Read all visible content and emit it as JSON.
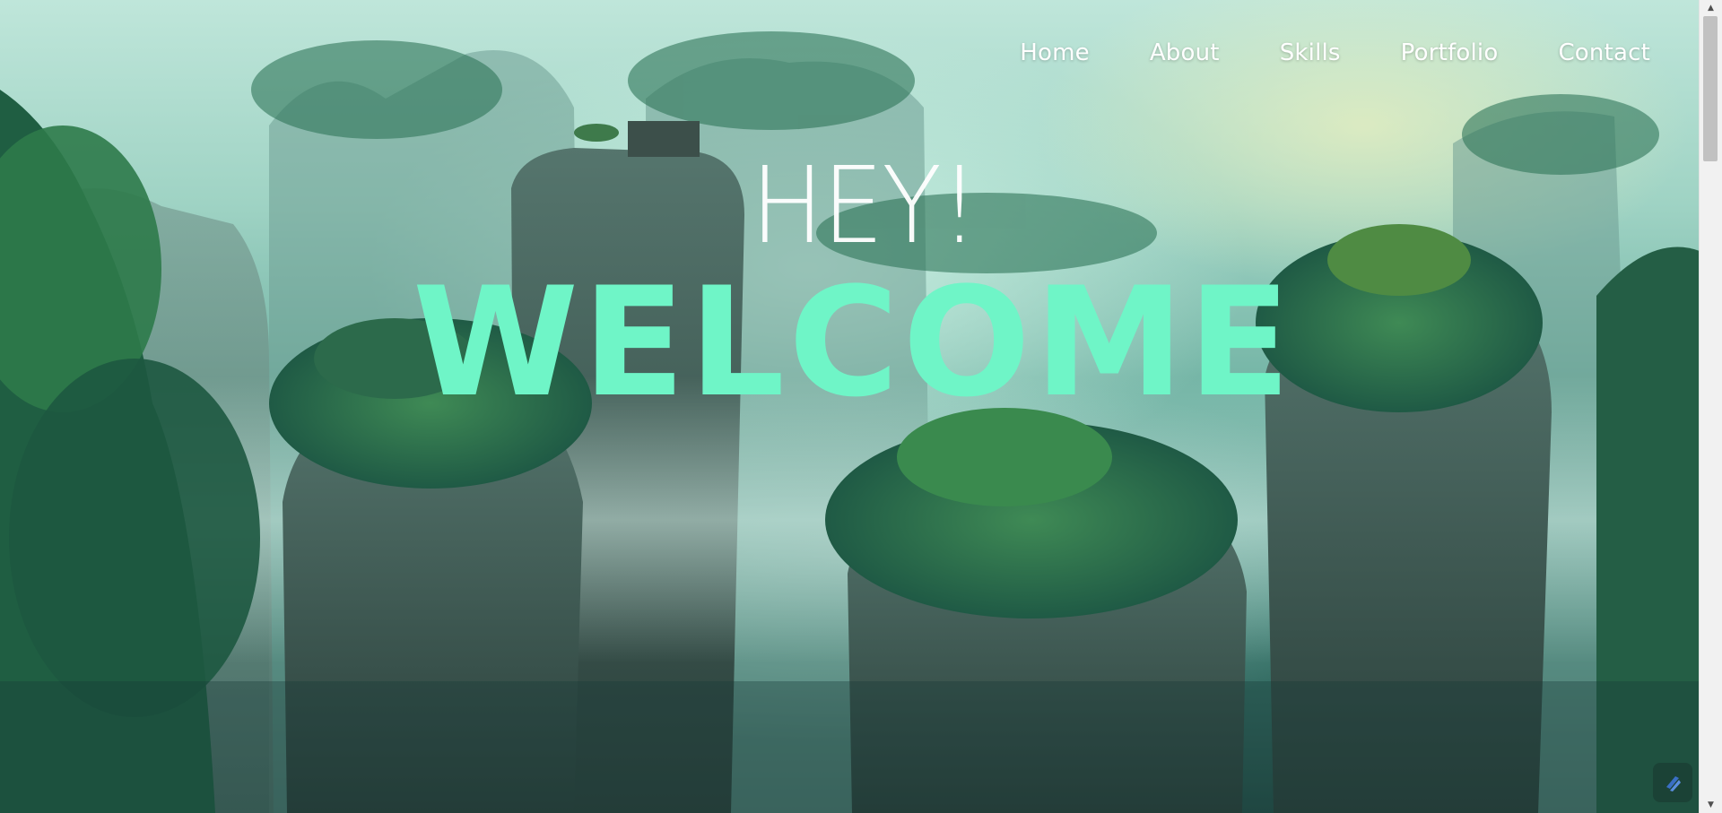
{
  "nav": {
    "items": [
      {
        "label": "Home"
      },
      {
        "label": "About"
      },
      {
        "label": "Skills"
      },
      {
        "label": "Portfolio"
      },
      {
        "label": "Contact"
      }
    ]
  },
  "hero": {
    "greeting": "HEY!",
    "headline": "WELCOME"
  },
  "colors": {
    "headline": "#6ff5c7",
    "nav_text": "#ffffff",
    "greeting": "#ffffff"
  },
  "icons": {
    "corner_widget": "app-logo-icon",
    "scroll_up": "scroll-up-arrow-icon",
    "scroll_down": "scroll-down-arrow-icon"
  }
}
